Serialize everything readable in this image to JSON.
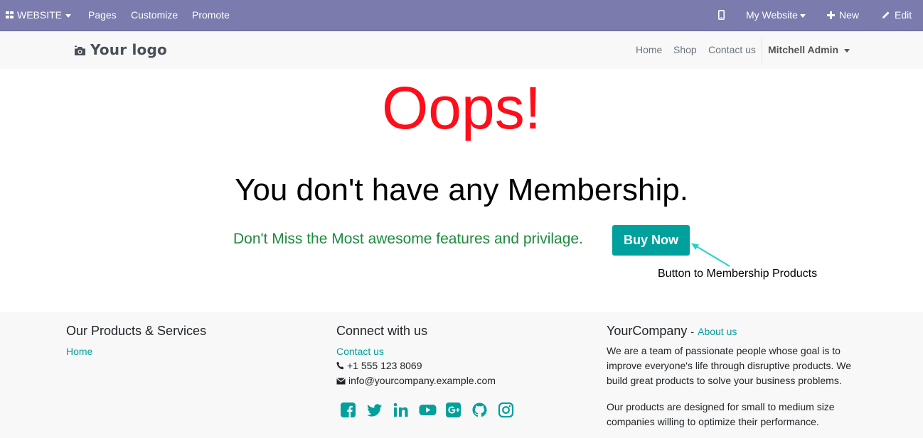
{
  "admin_bar": {
    "website_label": "WEBSITE",
    "pages": "Pages",
    "customize": "Customize",
    "promote": "Promote",
    "my_website": "My Website",
    "new": "New",
    "edit": "Edit",
    "icons": {
      "mobile": "mobile-icon",
      "plus": "plus-icon",
      "pencil": "pencil-icon",
      "apps": "apps-grid-icon"
    }
  },
  "header": {
    "logo": "Your logo",
    "nav": [
      "Home",
      "Shop",
      "Contact us"
    ],
    "user": "Mitchell Admin"
  },
  "main": {
    "oops": "Oops!",
    "message": "You don't have any Membership.",
    "subline": "Don't Miss the Most awesome features and privilage.",
    "buy_now": "Buy Now",
    "annotation": "Button to Membership Products"
  },
  "footer": {
    "col1": {
      "title": "Our Products & Services",
      "links": [
        "Home"
      ]
    },
    "col2": {
      "title": "Connect with us",
      "contact_link": "Contact us",
      "phone": "+1 555 123 8069",
      "email": "info@yourcompany.example.com",
      "social": [
        "facebook-icon",
        "twitter-icon",
        "linkedin-icon",
        "youtube-icon",
        "google-plus-icon",
        "github-icon",
        "instagram-icon"
      ]
    },
    "col3": {
      "company": "YourCompany",
      "separator": "-",
      "about_link": "About us",
      "para1": "We are a team of passionate people whose goal is to improve everyone's life through disruptive products. We build great products to solve your business problems.",
      "para2": "Our products are designed for small to medium size companies willing to optimize their performance."
    }
  },
  "colors": {
    "admin_bar": "#7c7bad",
    "accent": "#00a09d",
    "oops": "#ff0d1a",
    "subline": "#1c8b3b",
    "footer_bg": "#f8f8f8"
  }
}
